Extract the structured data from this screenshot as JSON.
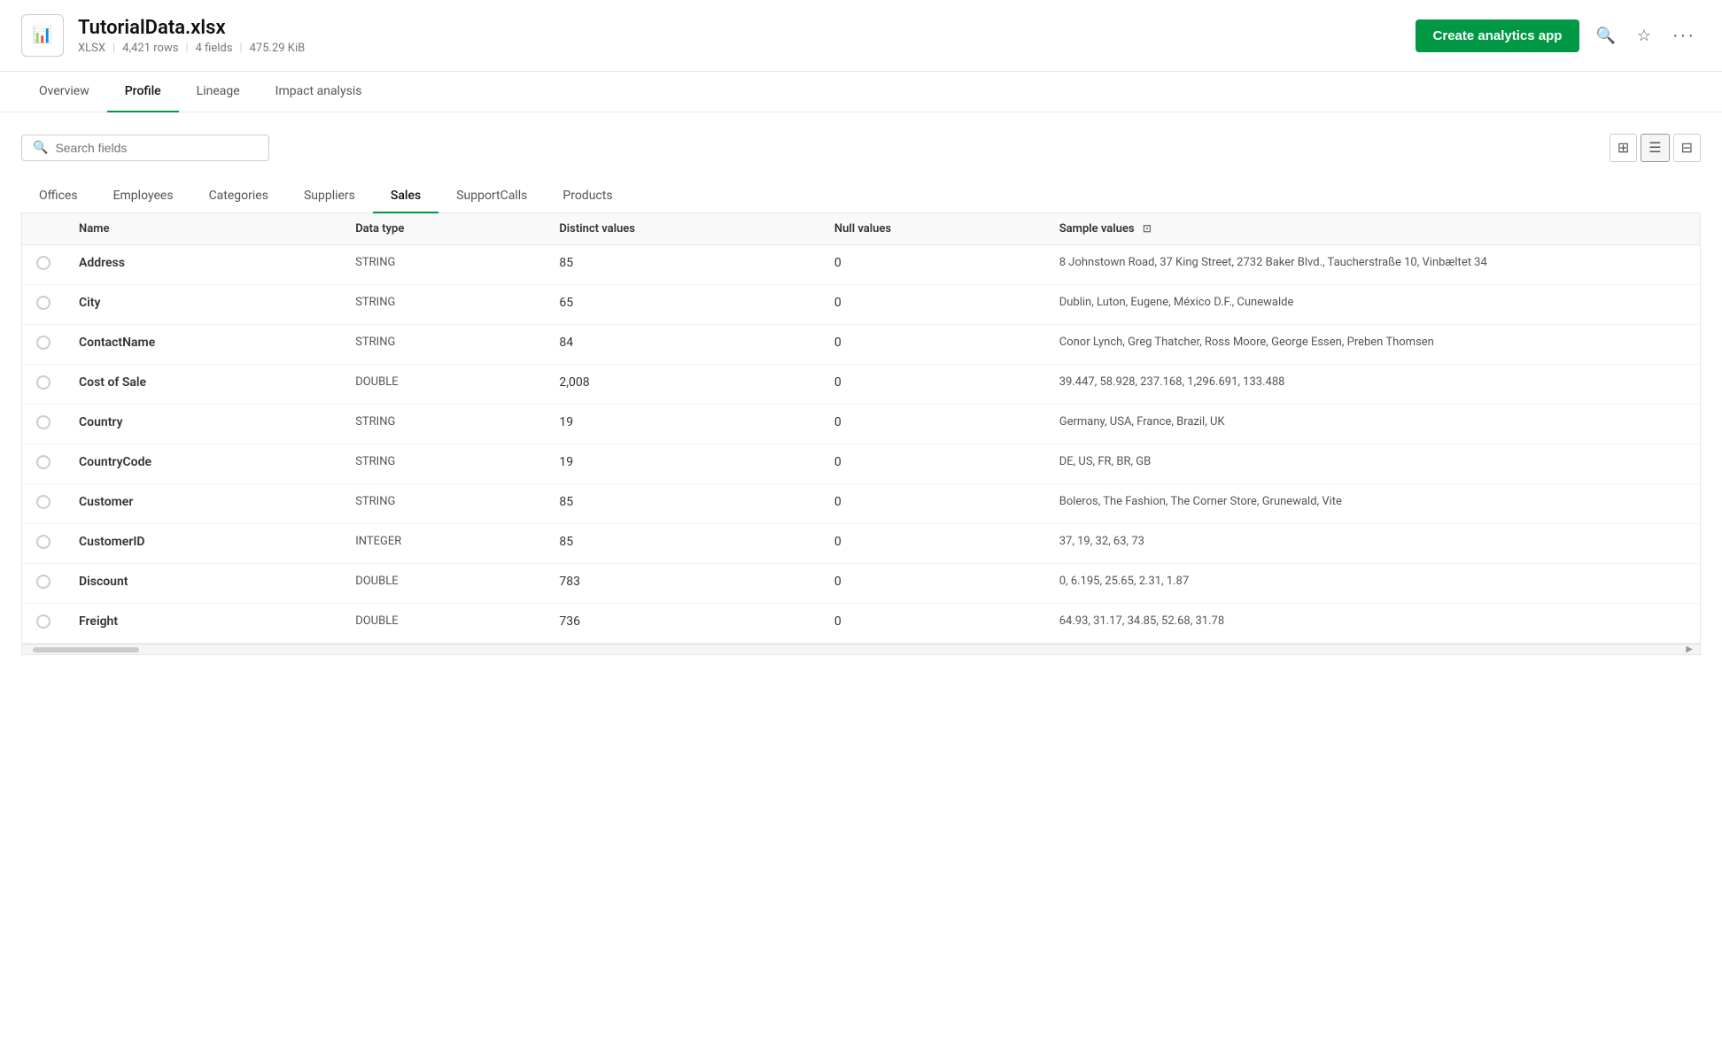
{
  "header": {
    "file_icon_line1": "XLSX",
    "title": "TutorialData.xlsx",
    "meta": {
      "format": "XLSX",
      "rows": "4,421 rows",
      "fields": "4 fields",
      "size": "475.29 KiB"
    },
    "create_btn_label": "Create analytics app"
  },
  "nav": {
    "tabs": [
      {
        "id": "overview",
        "label": "Overview",
        "active": false
      },
      {
        "id": "profile",
        "label": "Profile",
        "active": true
      },
      {
        "id": "lineage",
        "label": "Lineage",
        "active": false
      },
      {
        "id": "impact",
        "label": "Impact analysis",
        "active": false
      }
    ]
  },
  "toolbar": {
    "search_placeholder": "Search fields"
  },
  "filter_tabs": [
    {
      "id": "offices",
      "label": "Offices",
      "active": false
    },
    {
      "id": "employees",
      "label": "Employees",
      "active": false
    },
    {
      "id": "categories",
      "label": "Categories",
      "active": false
    },
    {
      "id": "suppliers",
      "label": "Suppliers",
      "active": false
    },
    {
      "id": "sales",
      "label": "Sales",
      "active": true
    },
    {
      "id": "supportcalls",
      "label": "SupportCalls",
      "active": false
    },
    {
      "id": "products",
      "label": "Products",
      "active": false
    }
  ],
  "table": {
    "columns": [
      {
        "id": "select",
        "label": ""
      },
      {
        "id": "name",
        "label": "Name"
      },
      {
        "id": "datatype",
        "label": "Data type"
      },
      {
        "id": "distinct",
        "label": "Distinct values"
      },
      {
        "id": "null",
        "label": "Null values"
      },
      {
        "id": "sample",
        "label": "Sample values"
      }
    ],
    "rows": [
      {
        "name": "Address",
        "datatype": "STRING",
        "distinct": "85",
        "null": "0",
        "sample": "8 Johnstown Road, 37 King Street, 2732 Baker Blvd., Taucherstraße 10, Vinbæltet 34"
      },
      {
        "name": "City",
        "datatype": "STRING",
        "distinct": "65",
        "null": "0",
        "sample": "Dublin, Luton, Eugene, México D.F., Cunewalde"
      },
      {
        "name": "ContactName",
        "datatype": "STRING",
        "distinct": "84",
        "null": "0",
        "sample": "Conor Lynch, Greg Thatcher, Ross Moore, George Essen, Preben Thomsen"
      },
      {
        "name": "Cost of Sale",
        "datatype": "DOUBLE",
        "distinct": "2,008",
        "null": "0",
        "sample": "39.447, 58.928, 237.168, 1,296.691, 133.488"
      },
      {
        "name": "Country",
        "datatype": "STRING",
        "distinct": "19",
        "null": "0",
        "sample": "Germany, USA, France, Brazil, UK"
      },
      {
        "name": "CountryCode",
        "datatype": "STRING",
        "distinct": "19",
        "null": "0",
        "sample": "DE, US, FR, BR, GB"
      },
      {
        "name": "Customer",
        "datatype": "STRING",
        "distinct": "85",
        "null": "0",
        "sample": "Boleros, The Fashion, The Corner Store, Grunewald, Vite"
      },
      {
        "name": "CustomerID",
        "datatype": "INTEGER",
        "distinct": "85",
        "null": "0",
        "sample": "37, 19, 32, 63, 73"
      },
      {
        "name": "Discount",
        "datatype": "DOUBLE",
        "distinct": "783",
        "null": "0",
        "sample": "0, 6.195, 25.65, 2.31, 1.87"
      },
      {
        "name": "Freight",
        "datatype": "DOUBLE",
        "distinct": "736",
        "null": "0",
        "sample": "64.93, 31.17, 34.85, 52.68, 31.78"
      }
    ]
  },
  "icons": {
    "search": "🔍",
    "grid_view": "⊞",
    "list_view": "☰",
    "table_view": "⊟",
    "search_header": "🔍",
    "star": "☆",
    "more": "•••"
  }
}
